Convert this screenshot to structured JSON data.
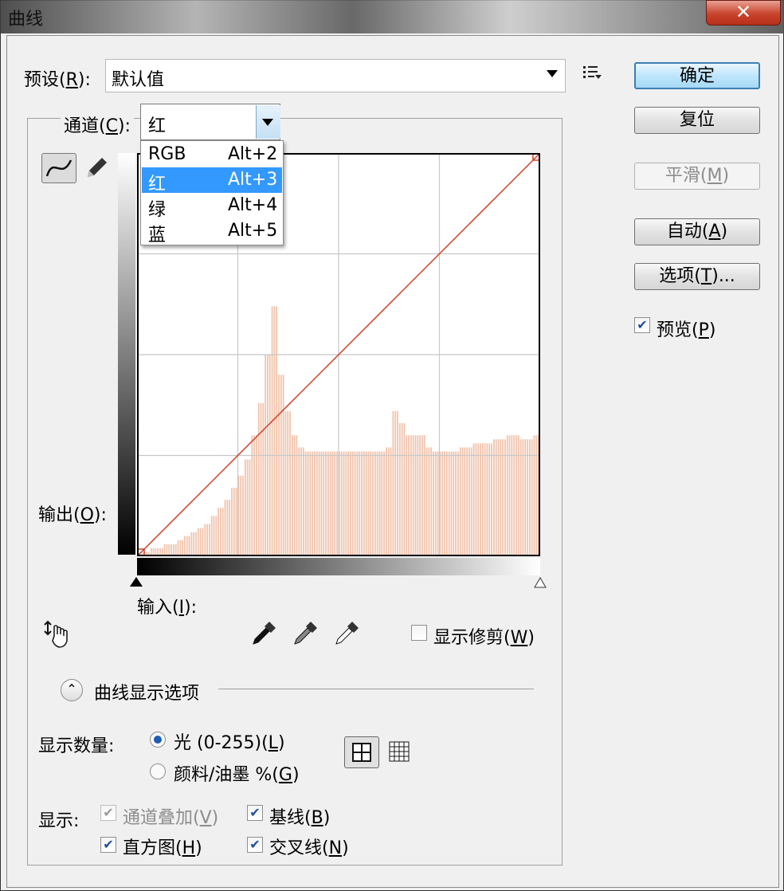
{
  "window": {
    "title": "曲线",
    "close_glyph": "✕"
  },
  "preset": {
    "label": "预设(",
    "mnemonic": "R",
    "suffix": "):",
    "value": "默认值",
    "menu_icon": "preset-options-icon"
  },
  "buttons": {
    "ok": {
      "label": "确定"
    },
    "reset": {
      "label": "复位"
    },
    "smooth": {
      "label": "平滑(",
      "mnemonic": "M",
      "suffix": ")"
    },
    "auto": {
      "label": "自动(",
      "mnemonic": "A",
      "suffix": ")"
    },
    "options": {
      "label": "选项(",
      "mnemonic": "T",
      "suffix": ")..."
    }
  },
  "preview": {
    "label": "预览(",
    "mnemonic": "P",
    "suffix": ")",
    "checked": true
  },
  "channel": {
    "label": "通道(",
    "mnemonic": "C",
    "suffix": "):",
    "value": "红",
    "options": [
      {
        "name": "RGB",
        "shortcut": "Alt+2",
        "selected": false
      },
      {
        "name": "红",
        "shortcut": "Alt+3",
        "selected": true
      },
      {
        "name": "绿",
        "shortcut": "Alt+4",
        "selected": false
      },
      {
        "name": "蓝",
        "shortcut": "Alt+5",
        "selected": false
      }
    ]
  },
  "axes": {
    "output": {
      "label": "输出(",
      "mnemonic": "O",
      "suffix": "):"
    },
    "input": {
      "label": "输入(",
      "mnemonic": "I",
      "suffix": "):"
    }
  },
  "show_clipping": {
    "label": "显示修剪(",
    "mnemonic": "W",
    "suffix": ")",
    "checked": false
  },
  "curve_options": {
    "label": "曲线显示选项"
  },
  "show_amount": {
    "label": "显示数量:",
    "light": {
      "label": "光 (0-255)(",
      "mnemonic": "L",
      "suffix": ")",
      "selected": true
    },
    "pigment": {
      "label": "颜料/油墨 %(",
      "mnemonic": "G",
      "suffix": ")",
      "selected": false
    }
  },
  "show": {
    "label": "显示:",
    "channel_overlay": {
      "label": "通道叠加(",
      "mnemonic": "V",
      "suffix": ")",
      "checked": true,
      "disabled": true
    },
    "baseline": {
      "label": "基线(",
      "mnemonic": "B",
      "suffix": ")",
      "checked": true
    },
    "histogram": {
      "label": "直方图(",
      "mnemonic": "H",
      "suffix": ")",
      "checked": true
    },
    "intersection": {
      "label": "交叉线(",
      "mnemonic": "N",
      "suffix": ")",
      "checked": true
    }
  },
  "colors": {
    "curve": "#d0402a",
    "histogram": "#f1c4ad",
    "grid": "#c8c8c8",
    "selection": "#3399ff"
  },
  "curve": {
    "points": [
      [
        0,
        0
      ],
      [
        255,
        255
      ]
    ]
  },
  "histogram": {
    "levels": [
      0.01,
      0.01,
      0.02,
      0.02,
      0.03,
      0.03,
      0.04,
      0.05,
      0.06,
      0.07,
      0.08,
      0.1,
      0.12,
      0.14,
      0.17,
      0.2,
      0.24,
      0.3,
      0.38,
      0.5,
      0.62,
      0.45,
      0.36,
      0.3,
      0.27,
      0.26,
      0.26,
      0.26,
      0.26,
      0.26,
      0.26,
      0.26,
      0.26,
      0.26,
      0.26,
      0.26,
      0.26,
      0.27,
      0.36,
      0.33,
      0.3,
      0.3,
      0.3,
      0.27,
      0.26,
      0.26,
      0.26,
      0.26,
      0.27,
      0.27,
      0.28,
      0.28,
      0.28,
      0.29,
      0.29,
      0.3,
      0.3,
      0.29,
      0.29,
      0.3
    ]
  }
}
